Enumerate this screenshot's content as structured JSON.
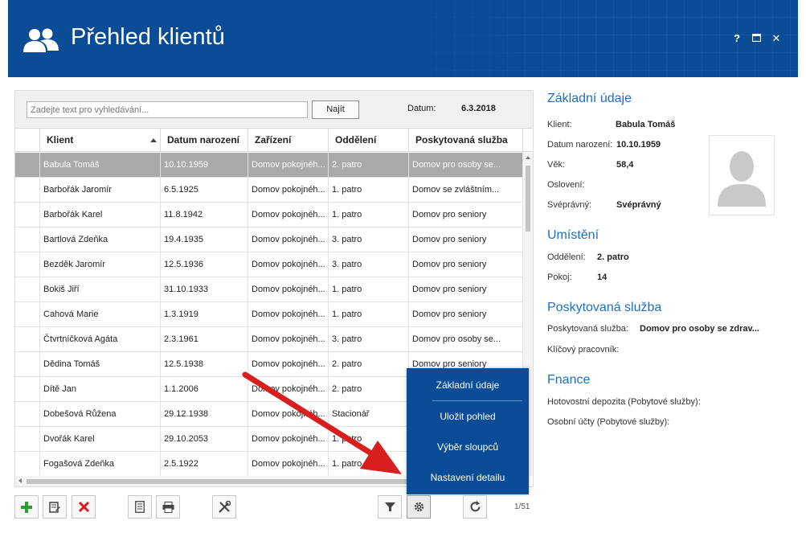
{
  "window": {
    "title": "Přehled klientů",
    "help": "?",
    "maximize": "□",
    "close": "✕"
  },
  "search": {
    "placeholder": "Zadejte text pro vyhledávání...",
    "button": "Najít",
    "date_label": "Datum:",
    "date_value": "6.3.2018"
  },
  "grid": {
    "columns": [
      "Klient",
      "Datum narození",
      "Zařízení",
      "Oddělení",
      "Poskytovaná služba"
    ],
    "rows": [
      [
        "Babula Tomáš",
        "10.10.1959",
        "Domov pokojnéh...",
        "2. patro",
        "Domov pro osoby se..."
      ],
      [
        "Barbořák Jaromír",
        "6.5.1925",
        "Domov pokojnéh...",
        "1. patro",
        "Domov se zvláštním..."
      ],
      [
        "Barbořák Karel",
        "11.8.1942",
        "Domov pokojnéh...",
        "1. patro",
        "Domov pro seniory"
      ],
      [
        "Bartlová Zdeňka",
        "19.4.1935",
        "Domov pokojnéh...",
        "3. patro",
        "Domov pro seniory"
      ],
      [
        "Bezděk Jaromír",
        "12.5.1936",
        "Domov pokojnéh...",
        "3. patro",
        "Domov pro seniory"
      ],
      [
        "Bokiš Jiří",
        "31.10.1933",
        "Domov pokojnéh...",
        "1. patro",
        "Domov pro seniory"
      ],
      [
        "Cahová Marie",
        "1.3.1919",
        "Domov pokojnéh...",
        "1. patro",
        "Domov pro seniory"
      ],
      [
        "Čtvrtníčková Agáta",
        "2.3.1961",
        "Domov pokojnéh...",
        "3. patro",
        "Domov pro osoby se..."
      ],
      [
        "Dědina Tomáš",
        "12.5.1938",
        "Domov pokojnéh...",
        "2. patro",
        "Domov pro seniory"
      ],
      [
        "Dítě Jan",
        "1.1.2006",
        "Domov pokojnéh...",
        "2. patro",
        ""
      ],
      [
        "Dobešová Růžena",
        "29.12.1938",
        "Domov pokojnéh...",
        "Stacionář",
        ""
      ],
      [
        "Dvořák Karel",
        "29.10.2053",
        "Domov pokojnéh...",
        "1. patro",
        ""
      ],
      [
        "Fogašová Zdeňka",
        "2.5.1922",
        "Domov pokojnéh...",
        "1. patro",
        ""
      ]
    ]
  },
  "popup_menu": [
    "Základní údaje",
    "Uložit pohled",
    "Výběr sloupců",
    "Nastavení detailu"
  ],
  "pager": "1/51",
  "details": {
    "basic": {
      "title": "Základní údaje",
      "fields": [
        {
          "label": "Klient:",
          "value": "Babula Tomáš"
        },
        {
          "label": "Datum narození:",
          "value": "10.10.1959"
        },
        {
          "label": "Věk:",
          "value": "58,4"
        },
        {
          "label": "Oslovení:",
          "value": ""
        },
        {
          "label": "Svéprávný:",
          "value": "Svéprávný"
        }
      ]
    },
    "placement": {
      "title": "Umístění",
      "fields": [
        {
          "label": "Oddělení:",
          "value": "2. patro"
        },
        {
          "label": "Pokoj:",
          "value": "14"
        }
      ]
    },
    "service": {
      "title": "Poskytovaná služba",
      "fields": [
        {
          "label": "Poskytovaná služba:",
          "value": "Domov pro osoby se zdrav..."
        },
        {
          "label": "Klíčový pracovník:",
          "value": ""
        }
      ]
    },
    "finance": {
      "title": "Fnance",
      "fields": [
        {
          "label": "Hotovostní depozita (Pobytové služby):",
          "value": ""
        },
        {
          "label": "Osobní účty (Pobytové služby):",
          "value": ""
        }
      ]
    }
  },
  "colors": {
    "brand": "#0a4c96",
    "accent_text": "#1e6fbf",
    "add": "#2e9e2e",
    "delete": "#d21f1f",
    "selection": "#a9a9a9",
    "arrow": "#d91e1e"
  }
}
